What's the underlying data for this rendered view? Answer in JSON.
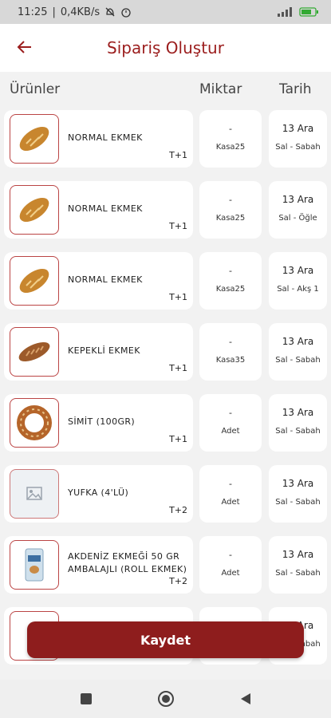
{
  "status": {
    "time": "11:25",
    "speed": "0,4KB/s"
  },
  "header": {
    "title": "Sipariş Oluştur"
  },
  "columns": {
    "products": "Ürünler",
    "quantity": "Miktar",
    "date": "Tarih"
  },
  "items": [
    {
      "name": "NORMAL EKMEK",
      "tag": "T+1",
      "qty": "-",
      "unit": "Kasa25",
      "date": "13 Ara",
      "slot": "Sal - Sabah",
      "image": "bread-icon"
    },
    {
      "name": "NORMAL EKMEK",
      "tag": "T+1",
      "qty": "-",
      "unit": "Kasa25",
      "date": "13 Ara",
      "slot": "Sal - Öğle",
      "image": "bread-icon"
    },
    {
      "name": "NORMAL EKMEK",
      "tag": "T+1",
      "qty": "-",
      "unit": "Kasa25",
      "date": "13 Ara",
      "slot": "Sal - Akş 1",
      "image": "bread-icon"
    },
    {
      "name": "KEPEKLİ EKMEK",
      "tag": "T+1",
      "qty": "-",
      "unit": "Kasa35",
      "date": "13 Ara",
      "slot": "Sal - Sabah",
      "image": "brown-bread-icon"
    },
    {
      "name": "SİMİT (100GR)",
      "tag": "T+1",
      "qty": "-",
      "unit": "Adet",
      "date": "13 Ara",
      "slot": "Sal - Sabah",
      "image": "simit-icon"
    },
    {
      "name": "YUFKA (4'LÜ)",
      "tag": "T+2",
      "qty": "-",
      "unit": "Adet",
      "date": "13 Ara",
      "slot": "Sal - Sabah",
      "image": "image-placeholder-icon"
    },
    {
      "name": "AKDENİZ EKMEĞİ 50 GR AMBALAJLI (ROLL EKMEK)",
      "tag": "T+2",
      "qty": "-",
      "unit": "Adet",
      "date": "13 Ara",
      "slot": "Sal - Sabah",
      "image": "package-icon"
    },
    {
      "name": "",
      "tag": "",
      "qty": "-",
      "unit": "",
      "date": "13 Ara",
      "slot": "Sal - Sabah",
      "image": ""
    }
  ],
  "actions": {
    "save": "Kaydet"
  },
  "colors": {
    "accent": "#9b1d1d",
    "button": "#8e1d1d"
  }
}
